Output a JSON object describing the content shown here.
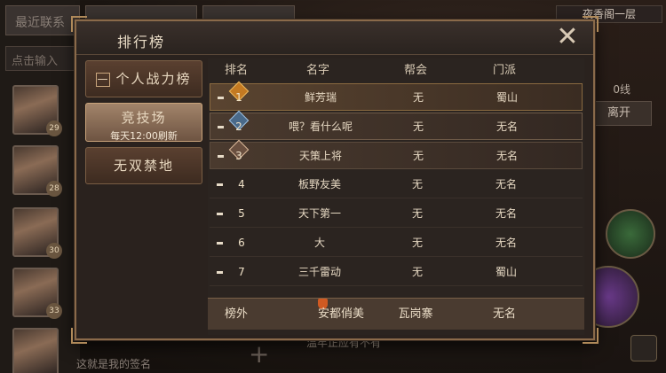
{
  "background": {
    "tab1": "最近联系",
    "tab2": "",
    "tab3": "",
    "search_placeholder": "点击输入",
    "avatars": [
      {
        "level": "29"
      },
      {
        "level": "28"
      },
      {
        "level": "30"
      },
      {
        "level": "33"
      },
      {
        "level": ""
      }
    ],
    "right_title": "夜香阁一层",
    "line_text": "0线",
    "leave_button": "离开",
    "bottom_text": "这就是我的签名",
    "bottom_text2": "温牢正应有不有"
  },
  "dialog": {
    "title": "排行榜",
    "close_icon": "close-x-icon"
  },
  "side_menu": [
    {
      "label": "个人战力榜",
      "sub": "",
      "active": false
    },
    {
      "label": "竞技场",
      "sub": "每天12:00刷新",
      "active": true
    },
    {
      "label": "无双禁地",
      "sub": "",
      "active": false
    }
  ],
  "table": {
    "headers": {
      "rank": "排名",
      "name": "名字",
      "guild": "帮会",
      "sect": "门派"
    },
    "rows": [
      {
        "rank": "1",
        "name": "鲜芳瑞",
        "guild": "无",
        "sect": "蜀山"
      },
      {
        "rank": "2",
        "name": "喂？看什么呢",
        "guild": "无",
        "sect": "无名"
      },
      {
        "rank": "3",
        "name": "天策上将",
        "guild": "无",
        "sect": "无名"
      },
      {
        "rank": "4",
        "name": "板野友美",
        "guild": "无",
        "sect": "无名"
      },
      {
        "rank": "5",
        "name": "天下第一",
        "guild": "无",
        "sect": "无名"
      },
      {
        "rank": "6",
        "name": "大",
        "guild": "无",
        "sect": "无名"
      },
      {
        "rank": "7",
        "name": "三千雷动",
        "guild": "无",
        "sect": "蜀山"
      }
    ],
    "self": {
      "rank": "榜外",
      "name": "安都俏美",
      "guild": "瓦岗寨",
      "sect": "无名"
    }
  },
  "colors": {
    "accent": "#c9a37a",
    "gold": "#c47a22"
  }
}
